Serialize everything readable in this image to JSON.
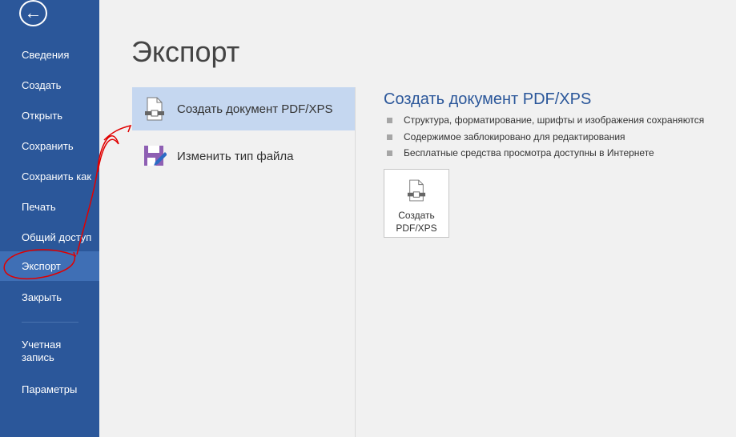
{
  "sidebar": {
    "back_label": "←",
    "items": [
      {
        "label": "Сведения"
      },
      {
        "label": "Создать"
      },
      {
        "label": "Открыть"
      },
      {
        "label": "Сохранить"
      },
      {
        "label": "Сохранить как"
      },
      {
        "label": "Печать"
      },
      {
        "label": "Общий доступ"
      },
      {
        "label": "Экспорт",
        "selected": true
      },
      {
        "label": "Закрыть"
      },
      {
        "label": "Учетная запись"
      },
      {
        "label": "Параметры"
      }
    ]
  },
  "main": {
    "title": "Экспорт",
    "options": [
      {
        "label": "Создать документ PDF/XPS",
        "selected": true
      },
      {
        "label": "Изменить тип файла"
      }
    ],
    "detail": {
      "heading": "Создать документ PDF/XPS",
      "bullets": [
        "Структура, форматирование, шрифты и изображения сохраняются",
        "Содержимое заблокировано для редактирования",
        "Бесплатные средства просмотра доступны в Интернете"
      ],
      "button_line1": "Создать",
      "button_line2": "PDF/XPS"
    }
  },
  "colors": {
    "sidebar": "#2b579a",
    "sidebar_selected": "#3f6fb5",
    "option_selected": "#c5d7f0",
    "annotation": "#e00000"
  }
}
